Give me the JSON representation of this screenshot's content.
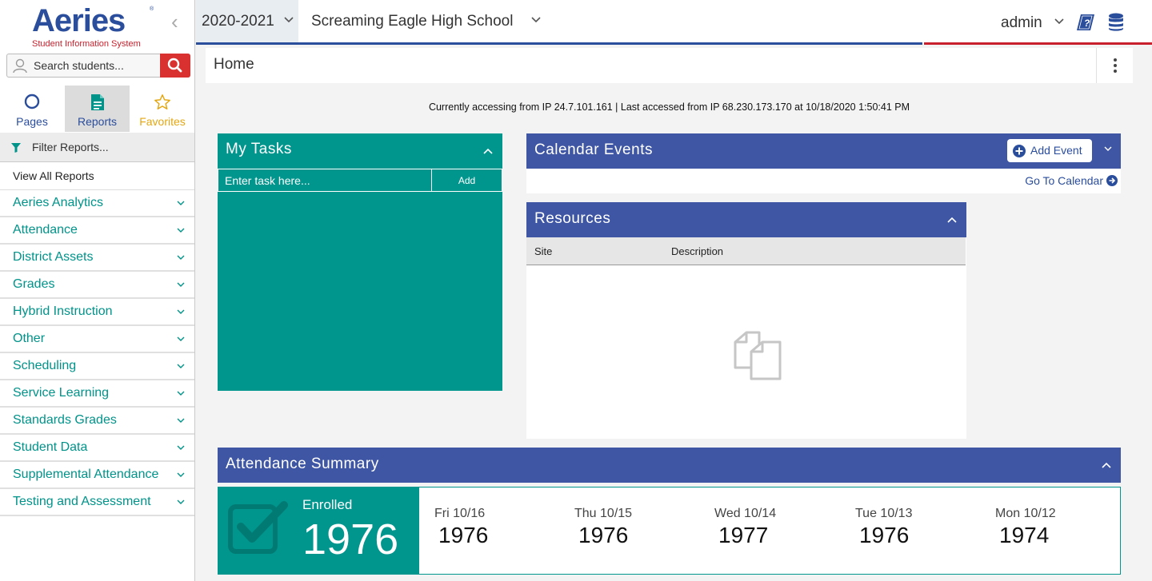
{
  "brand": {
    "name": "Aeries",
    "registered": "®",
    "tagline": "Student Information System"
  },
  "sidebar": {
    "search_placeholder": "Search students...",
    "tabs": [
      {
        "label": "Pages",
        "icon": "circle-icon"
      },
      {
        "label": "Reports",
        "icon": "report-icon",
        "active": true
      },
      {
        "label": "Favorites",
        "icon": "star-icon"
      }
    ],
    "filter_label": "Filter Reports...",
    "view_all": "View All Reports",
    "report_groups": [
      "Aeries Analytics",
      "Attendance",
      "District Assets",
      "Grades",
      "Hybrid Instruction",
      "Other",
      "Scheduling",
      "Service Learning",
      "Standards Grades",
      "Student Data",
      "Supplemental Attendance",
      "Testing and Assessment"
    ]
  },
  "topbar": {
    "year": "2020-2021",
    "school": "Screaming Eagle High School",
    "user": "admin"
  },
  "page": {
    "title": "Home",
    "access_info": "Currently accessing from IP 24.7.101.161 | Last accessed from IP 68.230.173.170 at 10/18/2020 1:50:41 PM"
  },
  "tasks": {
    "title": "My Tasks",
    "input_placeholder": "Enter task here...",
    "add_label": "Add"
  },
  "calendar": {
    "title": "Calendar Events",
    "add_event_label": "Add Event",
    "go_to_label": "Go To Calendar"
  },
  "resources": {
    "title": "Resources",
    "columns": [
      "Site",
      "Description"
    ]
  },
  "attendance": {
    "title": "Attendance Summary",
    "enrolled_label": "Enrolled",
    "enrolled_value": "1976",
    "days": [
      {
        "label": "Fri 10/16",
        "value": "1976"
      },
      {
        "label": "Thu 10/15",
        "value": "1976"
      },
      {
        "label": "Wed 10/14",
        "value": "1977"
      },
      {
        "label": "Tue 10/13",
        "value": "1976"
      },
      {
        "label": "Mon 10/12",
        "value": "1974"
      }
    ]
  },
  "colors": {
    "brand_blue": "#2a4d9c",
    "panel_blue": "#3f56a4",
    "teal": "#00958d",
    "red": "#c8202c",
    "favorites_gold": "#e4a712"
  }
}
